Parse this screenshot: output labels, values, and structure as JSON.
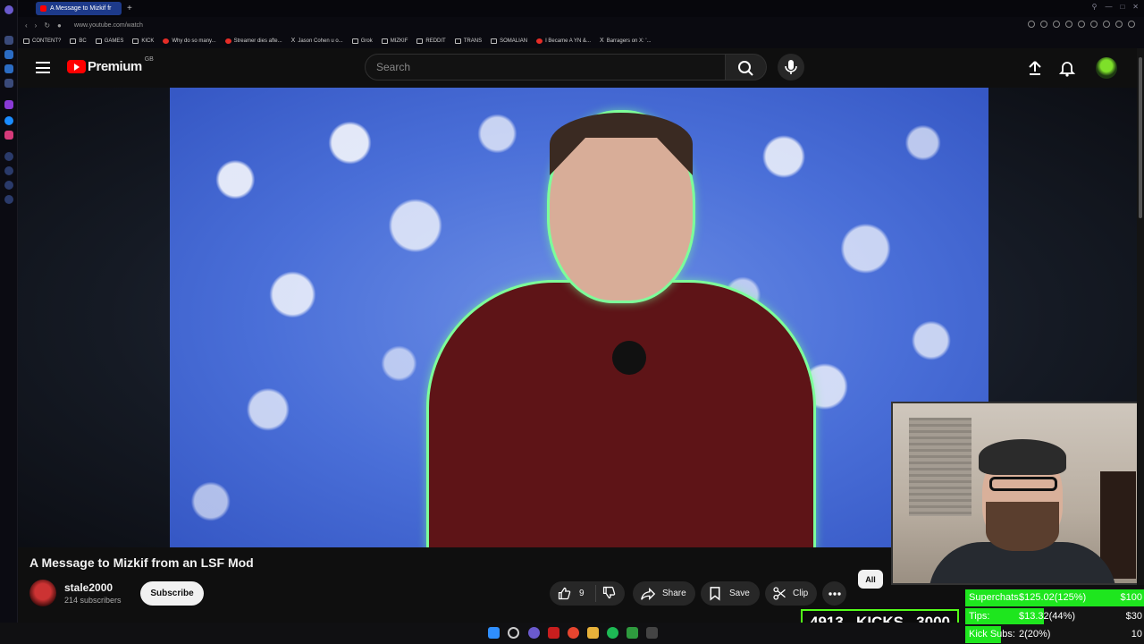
{
  "browser": {
    "tab_title": "A Message to Mizkif fr",
    "url": "www.youtube.com/watch",
    "bookmarks": [
      {
        "label": "CONTENT?",
        "icon": "folder-icon"
      },
      {
        "label": "BC",
        "icon": "folder-icon"
      },
      {
        "label": "GAMES",
        "icon": "folder-icon"
      },
      {
        "label": "KICK",
        "icon": "folder-icon"
      },
      {
        "label": "Why do so many...",
        "icon": "youtube-icon"
      },
      {
        "label": "Streamer dies afte...",
        "icon": "reddit-icon"
      },
      {
        "label": "Jason Cohen u o...",
        "icon": "x-icon"
      },
      {
        "label": "Grok",
        "icon": "folder-icon"
      },
      {
        "label": "MIZKIF",
        "icon": "folder-icon"
      },
      {
        "label": "REDDIT",
        "icon": "folder-icon"
      },
      {
        "label": "TRANS",
        "icon": "folder-icon"
      },
      {
        "label": "SOMALIAN",
        "icon": "folder-icon"
      },
      {
        "label": "I Became A YN &...",
        "icon": "youtube-icon"
      },
      {
        "label": "Barragers on X: '...",
        "icon": "x-icon"
      }
    ]
  },
  "header": {
    "logo_text": "Premium",
    "region": "GB",
    "search_placeholder": "Search"
  },
  "video": {
    "title": "A Message to Mizkif from an LSF Mod",
    "channel_name": "stale2000",
    "subscribers": "214 subscribers",
    "subscribe_label": "Subscribe",
    "likes": "9",
    "share_label": "Share",
    "save_label": "Save",
    "clip_label": "Clip",
    "chip_all": "All"
  },
  "overlay": {
    "kicks_current": "4913",
    "kicks_label": "KICKS",
    "kicks_goal": "3000",
    "goals": [
      {
        "label": "Superchats:",
        "value": "$125.02(125%)",
        "target": "$100",
        "fill": 1.0
      },
      {
        "label": "Tips:",
        "value": "$13.32(44%)",
        "target": "$30",
        "fill": 0.44
      },
      {
        "label": "Kick Subs:",
        "value": "2(20%)",
        "target": "10",
        "fill": 0.2
      }
    ]
  },
  "colors": {
    "youtube_red": "#ff0000",
    "kick_green": "#53fc18",
    "goal_fill": "#1ee61e"
  }
}
